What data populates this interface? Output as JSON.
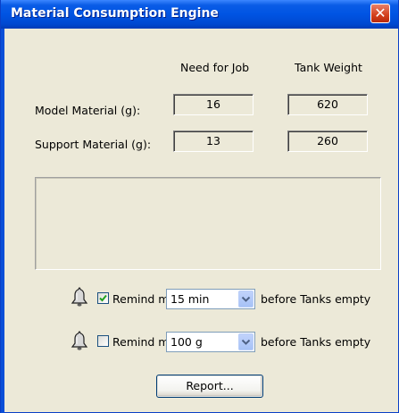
{
  "window": {
    "title": "Material Consumption Engine",
    "close_glyph": "✕"
  },
  "headers": {
    "need_for_job": "Need for Job",
    "tank_weight": "Tank Weight"
  },
  "rows": [
    {
      "label": "Model Material (g):",
      "need": "16",
      "tank": "620"
    },
    {
      "label": "Support Material (g):",
      "need": "13",
      "tank": "260"
    }
  ],
  "message_area": {
    "text": ""
  },
  "reminders": [
    {
      "checked": true,
      "label": "Remind me",
      "value": "15 min",
      "suffix": "before Tanks empty",
      "icon": "bell-icon"
    },
    {
      "checked": false,
      "label": "Remind me",
      "value": "100 g",
      "suffix": "before Tanks empty",
      "icon": "bell-icon"
    }
  ],
  "buttons": {
    "report": "Report..."
  },
  "colors": {
    "titlebar": "#0054e3",
    "dialog_bg": "#ece9d8",
    "close": "#d3401c",
    "check": "#21a121"
  }
}
